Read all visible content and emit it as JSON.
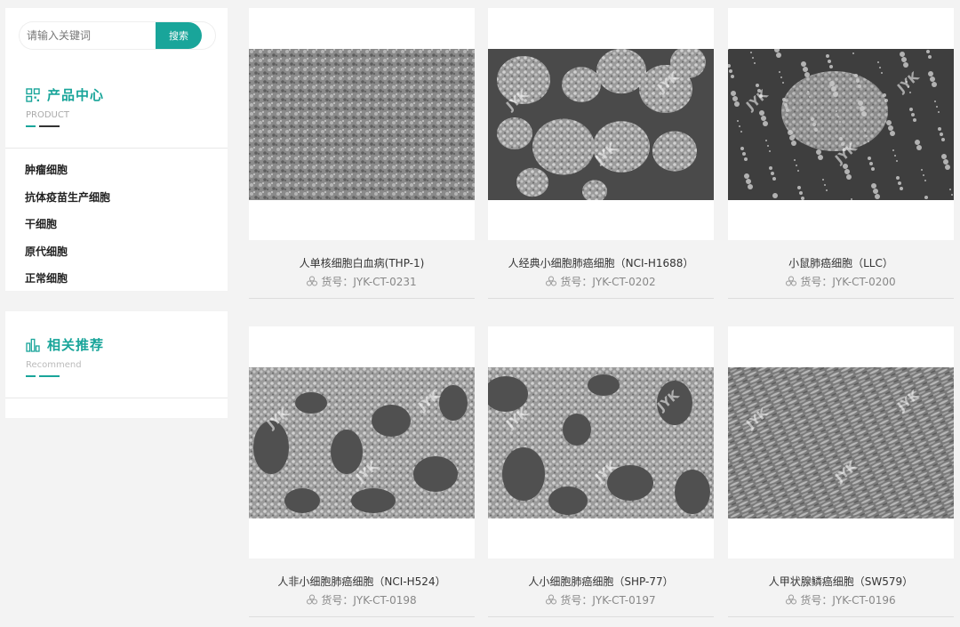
{
  "search": {
    "placeholder": "请输入关键词",
    "button_label": "搜索"
  },
  "product_section": {
    "title": "产品中心",
    "subtitle": "PRODUCT",
    "categories": [
      "肿瘤细胞",
      "抗体疫苗生产细胞",
      "干细胞",
      "原代细胞",
      "正常细胞"
    ]
  },
  "recommend_section": {
    "title": "相关推荐",
    "subtitle": "Recommend"
  },
  "watermark": "JYK",
  "colors": {
    "accent": "#19a59a",
    "background": "#f3f3f3"
  },
  "products": [
    {
      "name": "人单核细胞白血病(THP-1)",
      "code": "货号：JYK-CT-0231"
    },
    {
      "name": "人经典小细胞肺癌细胞（NCI-H1688）",
      "code": "货号：JYK-CT-0202"
    },
    {
      "name": "小鼠肺癌细胞（LLC）",
      "code": "货号：JYK-CT-0200"
    },
    {
      "name": "人非小细胞肺癌细胞（NCI-H524）",
      "code": "货号：JYK-CT-0198"
    },
    {
      "name": "人小细胞肺癌细胞（SHP-77）",
      "code": "货号：JYK-CT-0197"
    },
    {
      "name": "人甲状腺鳞癌细胞（SW579）",
      "code": "货号：JYK-CT-0196"
    }
  ]
}
